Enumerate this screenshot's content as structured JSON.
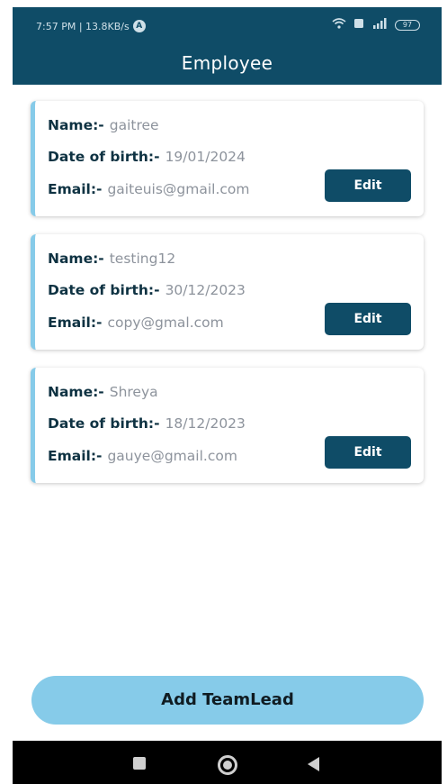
{
  "status_bar": {
    "time_info": "7:57 PM | 13.8KB/s",
    "battery": "97"
  },
  "header": {
    "title": "Employee"
  },
  "labels": {
    "name": "Name:-",
    "dob": "Date of birth:-",
    "email": "Email:-"
  },
  "employees": [
    {
      "name": "gaitree",
      "dob": "19/01/2024",
      "email": "gaiteuis@gmail.com",
      "edit_label": "Edit"
    },
    {
      "name": "testing12",
      "dob": "30/12/2023",
      "email": "copy@gmal.com",
      "edit_label": "Edit"
    },
    {
      "name": "Shreya",
      "dob": "18/12/2023",
      "email": "gauye@gmail.com",
      "edit_label": "Edit"
    }
  ],
  "actions": {
    "add_label": "Add TeamLead"
  },
  "colors": {
    "primary": "#0f4c67",
    "accent": "#86cbe9"
  }
}
